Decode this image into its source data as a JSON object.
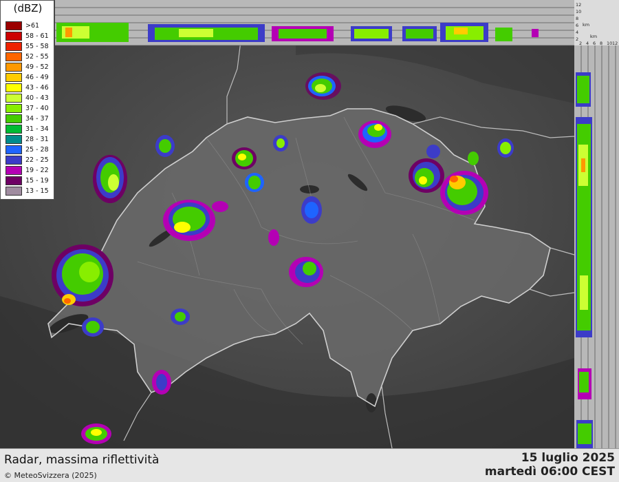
{
  "map": {
    "title": "Radar, massima riflettività",
    "copyright": "© MeteoSvizzera (2025)",
    "date": "15 luglio 2025",
    "time": "martedì 06:00 CEST"
  },
  "legend": {
    "title": "(dBZ)",
    "items": [
      {
        "label": ">61",
        "color": "#9b0000"
      },
      {
        "label": "58 - 61",
        "color": "#cc0000"
      },
      {
        "label": "55 - 58",
        "color": "#ee2200"
      },
      {
        "label": "52 - 55",
        "color": "#ff6600"
      },
      {
        "label": "49 - 52",
        "color": "#ff9900"
      },
      {
        "label": "46 - 49",
        "color": "#ffcc00"
      },
      {
        "label": "43 - 46",
        "color": "#ffff00"
      },
      {
        "label": "40 - 43",
        "color": "#ccff33"
      },
      {
        "label": "37 - 40",
        "color": "#88ee00"
      },
      {
        "label": "34 - 37",
        "color": "#44cc00"
      },
      {
        "label": "31 - 34",
        "color": "#00bb33"
      },
      {
        "label": "28 - 31",
        "color": "#008c8c"
      },
      {
        "label": "25 - 28",
        "color": "#1e64ff"
      },
      {
        "label": "22 - 25",
        "color": "#3c3cc8"
      },
      {
        "label": "19 - 22",
        "color": "#b400b4"
      },
      {
        "label": "15 - 19",
        "color": "#6e0064"
      },
      {
        "label": "13 - 15",
        "color": "#a08ca0"
      }
    ]
  },
  "top_panel": {
    "height_ticks": [
      "12",
      "10",
      "8",
      "6",
      "4",
      "2"
    ],
    "unit": "km"
  },
  "side_panel": {
    "distance_ticks": [
      "2",
      "4",
      "6",
      "8",
      "10",
      "12"
    ],
    "unit": "km"
  }
}
